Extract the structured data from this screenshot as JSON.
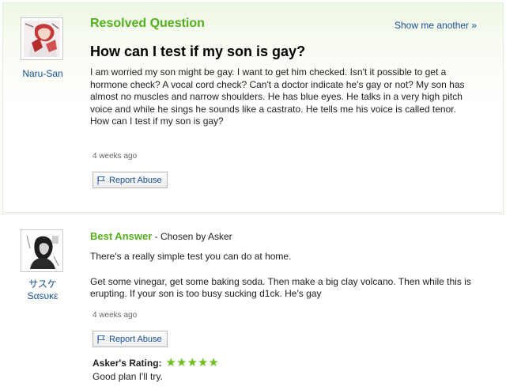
{
  "question": {
    "status_label": "Resolved Question",
    "show_another_label": "Show me another »",
    "title": "How can I test if my son is gay?",
    "body_paragraphs": [
      "I am worried my son might be gay. I want to get him checked. Isn't it possible to get a hormone check? A vocal cord check? Can't a doctor indicate he's gay or not? My son has almost no muscles and narrow shoulders. He has blue eyes. He talks in a very high pitch voice and while he sings he sounds like a castrato. He tells me his voice is called tenor.",
      "How can I test if my son is gay?"
    ],
    "timestamp": "4 weeks ago",
    "report_label": "Report Abuse",
    "asker": {
      "name": "Naru-San",
      "avatar_icon": "user-avatar"
    }
  },
  "answer": {
    "best_label": "Best Answer",
    "chosen_by": " - Chosen by Asker",
    "body_paragraphs": [
      "There's a really simple test you can do at home.",
      "Get some vinegar, get some baking soda. Then make a big clay volcano. Then while this is erupting. If your son is too busy sucking d1ck. He's gay"
    ],
    "timestamp": "4 weeks ago",
    "report_label": "Report Abuse",
    "answerer": {
      "name_line1": "サスケ",
      "name_line2": "Sαsυκε",
      "avatar_icon": "user-avatar"
    },
    "rating_label": "Asker's Rating:",
    "rating_stars": "★★★★★",
    "rating_value": 5,
    "rating_max": 5,
    "rating_comment": "Good plan I'll try."
  },
  "colors": {
    "green": "#52b01c",
    "link": "#16509a",
    "star": "#6cbf1c"
  }
}
